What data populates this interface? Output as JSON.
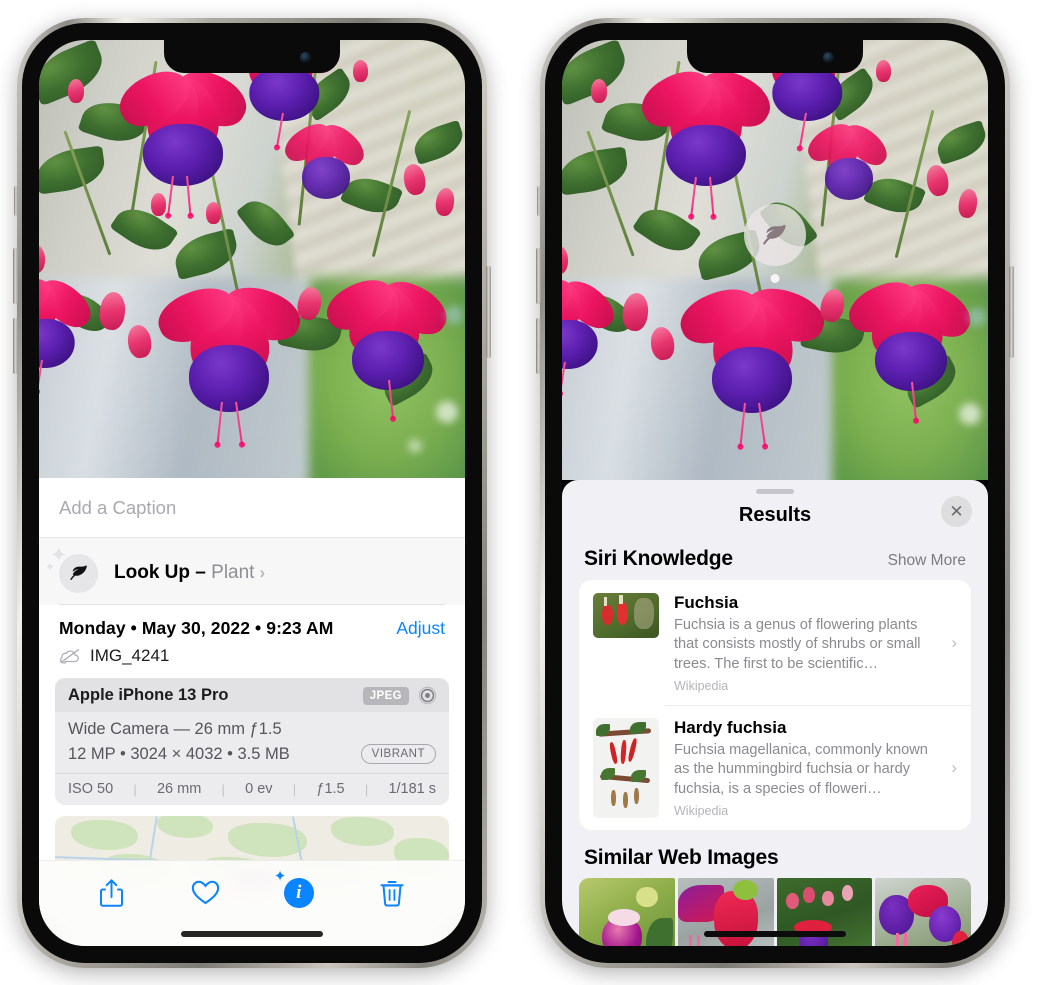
{
  "left_phone": {
    "caption": {
      "placeholder": "Add a Caption",
      "value": ""
    },
    "lookup": {
      "label": "Look Up",
      "dash": "–",
      "subject": "Plant",
      "chevron": "›",
      "icon": "leaf-icon"
    },
    "meta": {
      "date": "Monday • May 30, 2022 • 9:23 AM",
      "adjust_label": "Adjust",
      "filename": "IMG_4241",
      "cloud_icon": "cloud-slash-icon"
    },
    "exif": {
      "device": "Apple iPhone 13 Pro",
      "format_badge": "JPEG",
      "lens_icon": "aperture-icon",
      "lens": "Wide Camera — 26 mm ƒ1.5",
      "dimensions": "12 MP • 3024 × 4032 • 3.5 MB",
      "style_badge": "VIBRANT",
      "stats": [
        "ISO 50",
        "26 mm",
        "0 ev",
        "ƒ1.5",
        "1/181 s"
      ],
      "separator": "|"
    },
    "toolbar": [
      {
        "name": "share-button",
        "icon": "share-icon"
      },
      {
        "name": "favorite-button",
        "icon": "heart-icon"
      },
      {
        "name": "info-button",
        "icon": "info-sparkle-icon",
        "active": true
      },
      {
        "name": "delete-button",
        "icon": "trash-icon"
      }
    ]
  },
  "right_phone": {
    "marker": {
      "icon": "leaf-icon"
    },
    "sheet": {
      "title": "Results",
      "close_label": "✕",
      "grabber": true
    },
    "siri_knowledge": {
      "title": "Siri Knowledge",
      "show_more": "Show More",
      "cards": [
        {
          "title": "Fuchsia",
          "description": "Fuchsia is a genus of flowering plants that consists mostly of shrubs or small trees. The first to be scientific…",
          "source": "Wikipedia",
          "chevron": "›"
        },
        {
          "title": "Hardy fuchsia",
          "description": "Fuchsia magellanica, commonly known as the hummingbird fuchsia or hardy fuchsia, is a species of floweri…",
          "source": "Wikipedia",
          "chevron": "›"
        }
      ]
    },
    "similar_web_images": {
      "title": "Similar Web Images",
      "count": 4
    }
  },
  "colors": {
    "accent_blue": "#0a84ff",
    "sheet_bg": "#f1f0f5",
    "card_bg": "#ffffff",
    "exif_bg": "#ececee",
    "muted_text": "#8e8e93"
  }
}
